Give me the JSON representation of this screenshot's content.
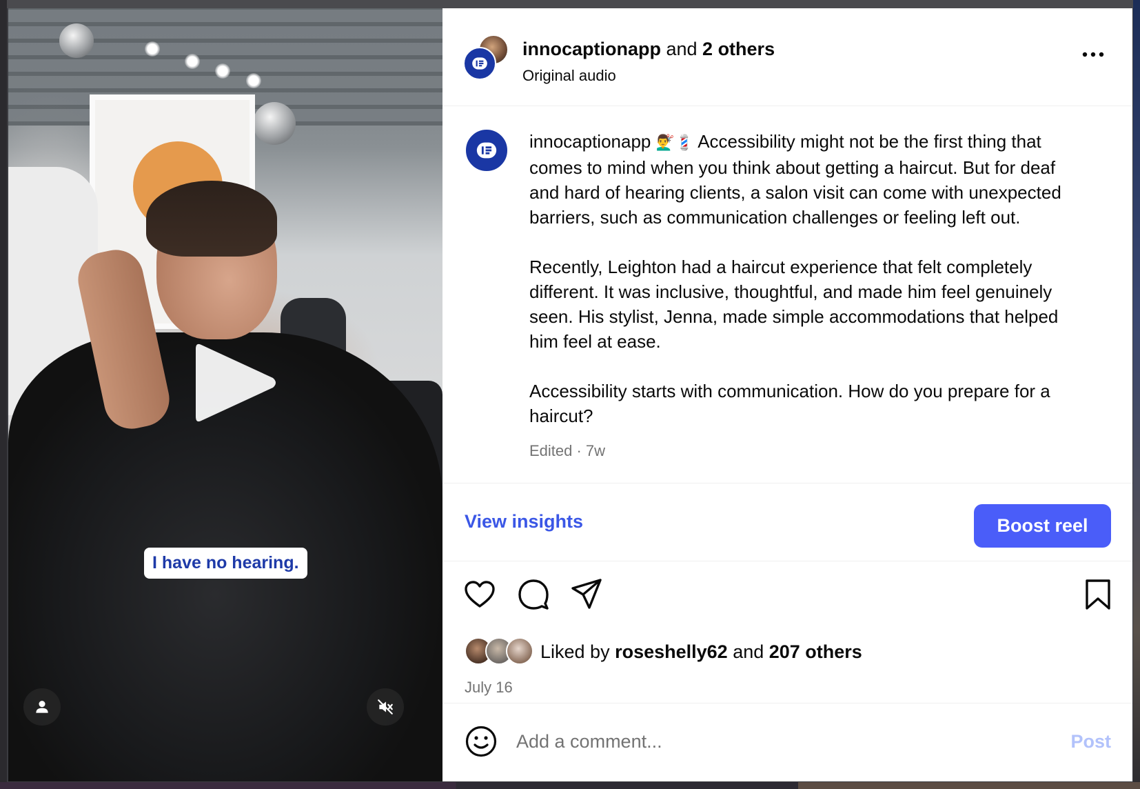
{
  "video": {
    "caption_overlay": "I have no hearing.",
    "icons": {
      "play": "play-icon",
      "profile": "user-icon",
      "mute": "muted-speaker-icon"
    }
  },
  "header": {
    "username": "innocaptionapp",
    "joiner": " and ",
    "others": "2 others",
    "audio": "Original audio"
  },
  "caption": {
    "username": "innocaptionapp",
    "emoji": "💇‍♂️💈",
    "paragraphs": [
      " Accessibility might not be the first thing that comes to mind when you think about getting a haircut. But for deaf and hard of hearing clients, a salon visit can come with unexpected barriers, such as communication challenges or feeling left out.",
      "Recently, Leighton had a haircut experience that felt completely different. It was inclusive, thoughtful, and made him feel genuinely seen. His stylist, Jenna, made simple accommodations that helped him feel at ease.",
      "Accessibility starts with communication. How do you prepare for a haircut?"
    ],
    "meta": "Edited · 7w"
  },
  "actions": {
    "view_insights": "View insights",
    "boost": "Boost reel"
  },
  "engagement": {
    "liked_by_prefix": "Liked by ",
    "liked_by_user": "roseshelly62",
    "liked_by_joiner": " and ",
    "liked_by_count": "207 others",
    "date": "July 16"
  },
  "comment": {
    "placeholder": "Add a comment...",
    "post": "Post"
  },
  "colors": {
    "brand_blue": "#1a37a4",
    "link_blue": "#3b57e6",
    "button_blue": "#4a5df9",
    "post_disabled": "#b2c2fb",
    "muted_text": "#737373"
  }
}
